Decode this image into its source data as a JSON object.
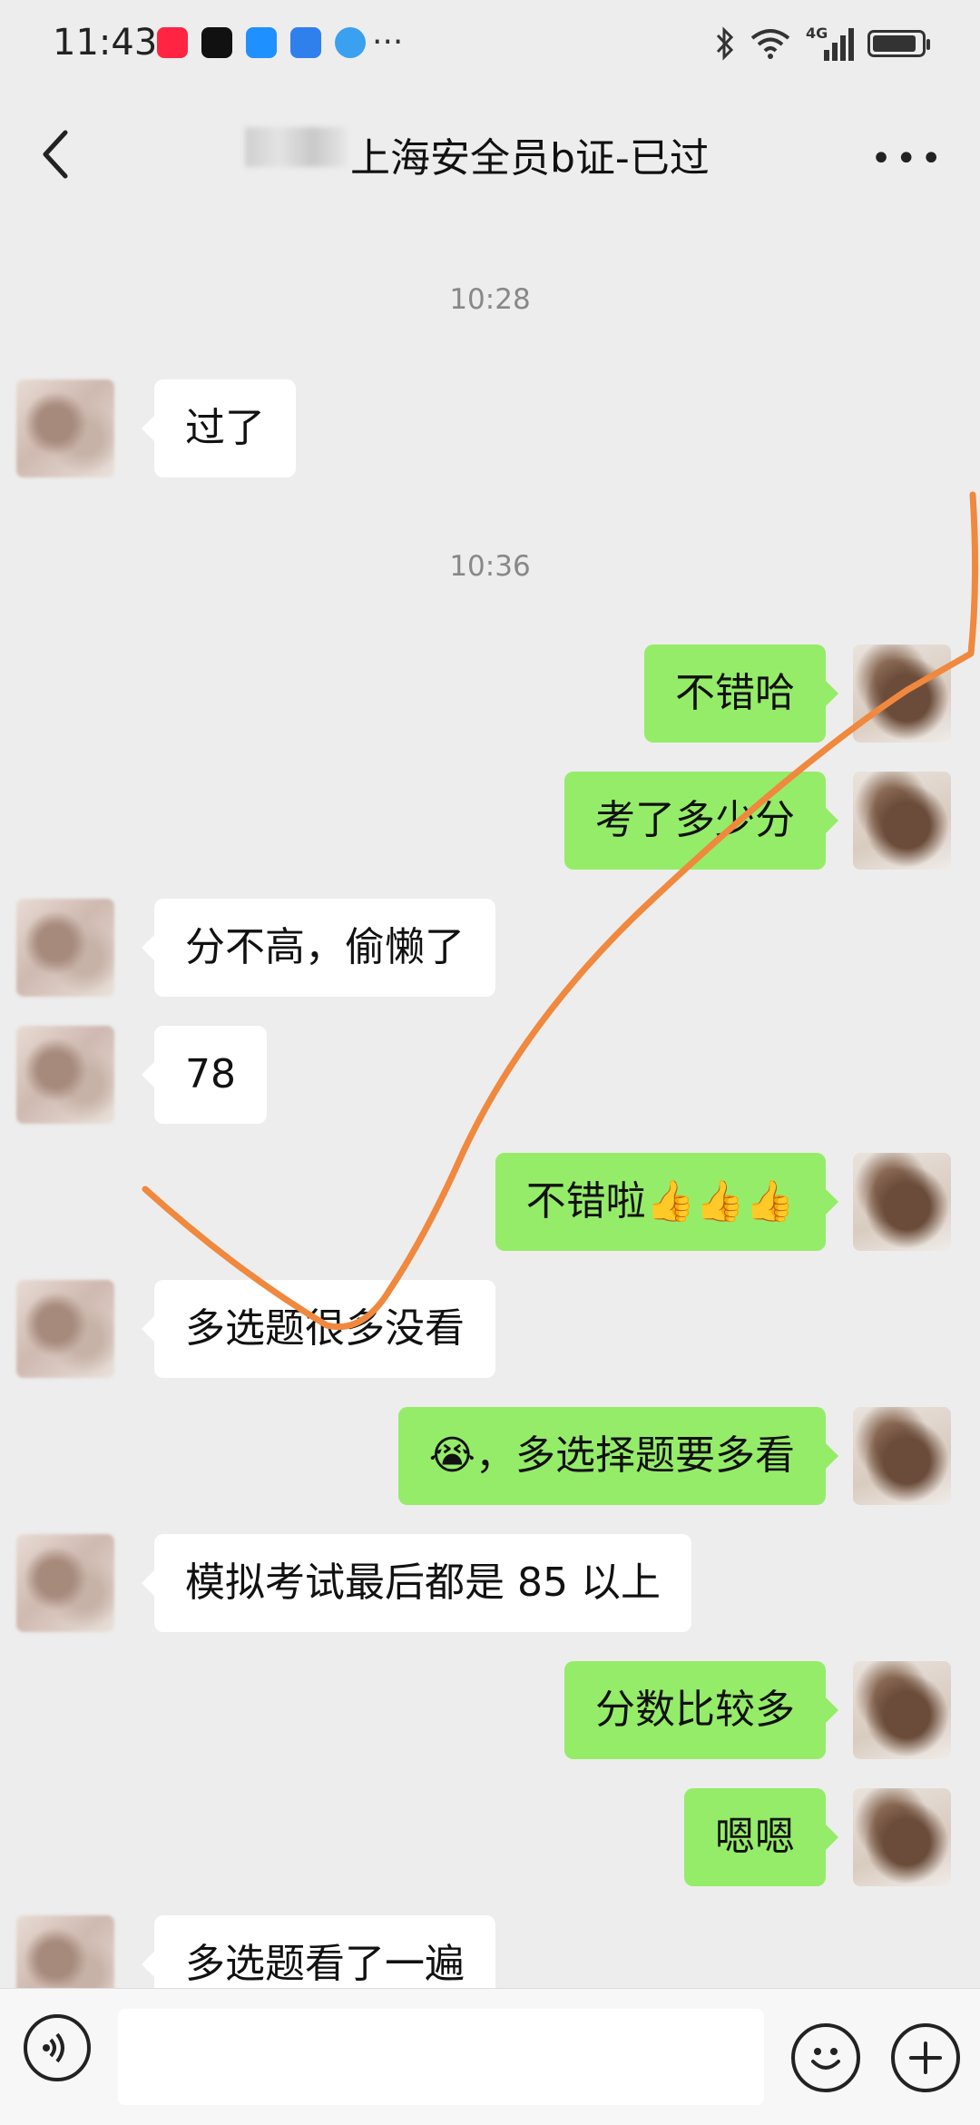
{
  "status_bar": {
    "time": "11:43",
    "network": "4G"
  },
  "header": {
    "title": "上海安全员b证-已过"
  },
  "messages": [
    {
      "type": "timestamp",
      "text": "10:28"
    },
    {
      "type": "in",
      "text": "过了"
    },
    {
      "type": "timestamp",
      "text": "10:36"
    },
    {
      "type": "out",
      "text": "不错哈"
    },
    {
      "type": "out",
      "text": "考了多少分"
    },
    {
      "type": "in",
      "text": "分不高，偷懒了"
    },
    {
      "type": "in",
      "text": "78"
    },
    {
      "type": "out",
      "text": "不错啦👍👍👍"
    },
    {
      "type": "in",
      "text": "多选题很多没看"
    },
    {
      "type": "out",
      "text": "😭，多选择题要多看"
    },
    {
      "type": "in",
      "text": "模拟考试最后都是 85 以上"
    },
    {
      "type": "out",
      "text": "分数比较多"
    },
    {
      "type": "out",
      "text": "嗯嗯"
    },
    {
      "type": "in",
      "text": "多选题看了一遍"
    }
  ],
  "colors": {
    "background": "#ededed",
    "bubble_in": "#ffffff",
    "bubble_out": "#95ec69",
    "annotation_line": "#f0883e"
  },
  "icons": {
    "back": "chevron-left-icon",
    "more": "more-dots-icon",
    "voice": "voice-icon",
    "emoji": "emoji-icon",
    "plus": "plus-icon"
  }
}
